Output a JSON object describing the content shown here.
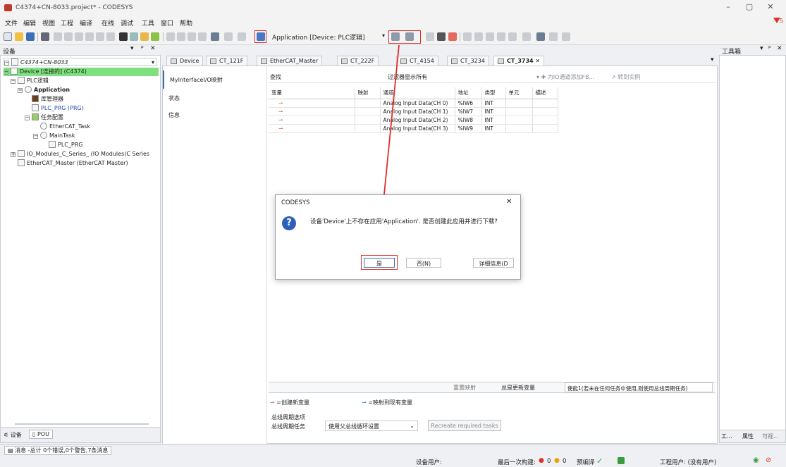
{
  "window": {
    "title": "C4374+CN-8033.project* - CODESYS",
    "minimize": "–",
    "restore": "▢",
    "close": "✕",
    "notify_count": "5"
  },
  "menu": [
    "文件",
    "编辑",
    "视图",
    "工程",
    "编译",
    "在线",
    "调试",
    "工具",
    "窗口",
    "帮助"
  ],
  "toolbar": {
    "app_selector": "Application [Device: PLC逻辑]"
  },
  "devices_pane": {
    "title": "设备",
    "tree": [
      "C4374+CN-8033",
      "Device [连接的] (C4374)",
      "PLC逻辑",
      "Application",
      "库管理器",
      "PLC_PRG (PRG)",
      "任务配置",
      "EtherCAT_Task",
      "MainTask",
      "PLC_PRG",
      "IO_Modules_C_Series_ (IO Modules(C Series",
      "EtherCAT_Master (EtherCAT Master)"
    ],
    "bottom_tabs": [
      "设备",
      "POU"
    ]
  },
  "tabs": [
    "Device",
    "CT_121F",
    "EtherCAT_Master",
    "CT_222F",
    "CT_4154",
    "CT_3234",
    "CT_3734"
  ],
  "active_tab_close": "✕",
  "editor": {
    "subnav": [
      "MyInterfaceI/O映射",
      "状态",
      "信息"
    ],
    "find_label": "查找",
    "filter_label": "过滤器",
    "filter_value": "显示所有",
    "add_fb": "为IO通道添加FB...",
    "goto_instance": "转到实例",
    "columns": [
      "变量",
      "映射",
      "通道",
      "地址",
      "类型",
      "单元",
      "描述"
    ],
    "rows": [
      {
        "channel": "Analog Input Data(CH 0)",
        "address": "%IW6",
        "type": "INT"
      },
      {
        "channel": "Analog Input Data(CH 1)",
        "address": "%IW7",
        "type": "INT"
      },
      {
        "channel": "Analog Input Data(CH 2)",
        "address": "%IW8",
        "type": "INT"
      },
      {
        "channel": "Analog Input Data(CH 3)",
        "address": "%IW9",
        "type": "INT"
      }
    ],
    "reset_mapping": "重置映射",
    "always_update": "总是更新变量",
    "update_option": "使能1(若未在任何任务中使用,则使用总线周期任务)",
    "legend_new": "=创建新变量",
    "legend_map": "=映射到现有变量",
    "bus_cycle_title": "总线周期选项",
    "bus_cycle_task": "总线周期任务",
    "bus_cycle_value": "使用父总线循环设置",
    "recreate_button": "Recreate required tasks"
  },
  "toolbox_pane": {
    "title": "工具箱",
    "bottom": [
      "工...",
      "属性",
      "可视..."
    ]
  },
  "messages_bar": "消息 -总计 0个错误,0个警告,7条消息",
  "status": {
    "device_user": "设备用户:",
    "last_build": "最后一次构建:",
    "err": "0",
    "warn": "0",
    "precompile": "预编译",
    "project_user": "工程用户: (没有用户)"
  },
  "dialog": {
    "title": "CODESYS",
    "message": "设备'Device'上不存在应用'Application'. 是否创建此应用并进行下载?",
    "yes": "是",
    "no": "否(N)",
    "details": "详细信息(D",
    "close": "✕"
  },
  "colors": {
    "highlight_green": "#7fe07f",
    "red_annotation": "#e0302a",
    "accent_blue": "#2e60b8"
  }
}
